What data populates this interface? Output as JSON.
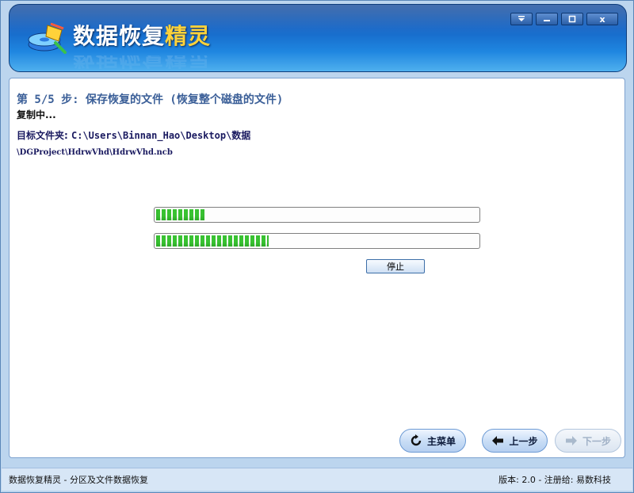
{
  "app": {
    "title_main": "数据恢复",
    "title_accent": "精灵"
  },
  "window_controls": {
    "menu_icon": "dropdown-arrow",
    "minimize_icon": "minimize",
    "maximize_icon": "maximize",
    "close_label": "x"
  },
  "main": {
    "step_title": "第 5/5 步: 保存恢复的文件 (恢复整个磁盘的文件)",
    "status": "复制中...",
    "target_label": "目标文件夹:",
    "target_path": "C:\\Users\\Binnan_Hao\\Desktop\\数据",
    "current_file": "\\DGProject\\HdrwVhd\\HdrwVhd.ncb",
    "progress": [
      {
        "name": "file-progress",
        "percent": 15
      },
      {
        "name": "total-progress",
        "percent": 35
      }
    ],
    "stop_label": "停止"
  },
  "nav": {
    "main_menu_label": "主菜单",
    "prev_label": "上一步",
    "next_label": "下一步",
    "next_disabled": true
  },
  "statusbar": {
    "left": "数据恢复精灵 - 分区及文件数据恢复",
    "right": "版本: 2.0 - 注册给: 易数科技"
  },
  "colors": {
    "header_blue": "#1565c6",
    "progress_green": "#39c232",
    "title_blue": "#3b5f98",
    "title_accent": "#ffd23a"
  }
}
